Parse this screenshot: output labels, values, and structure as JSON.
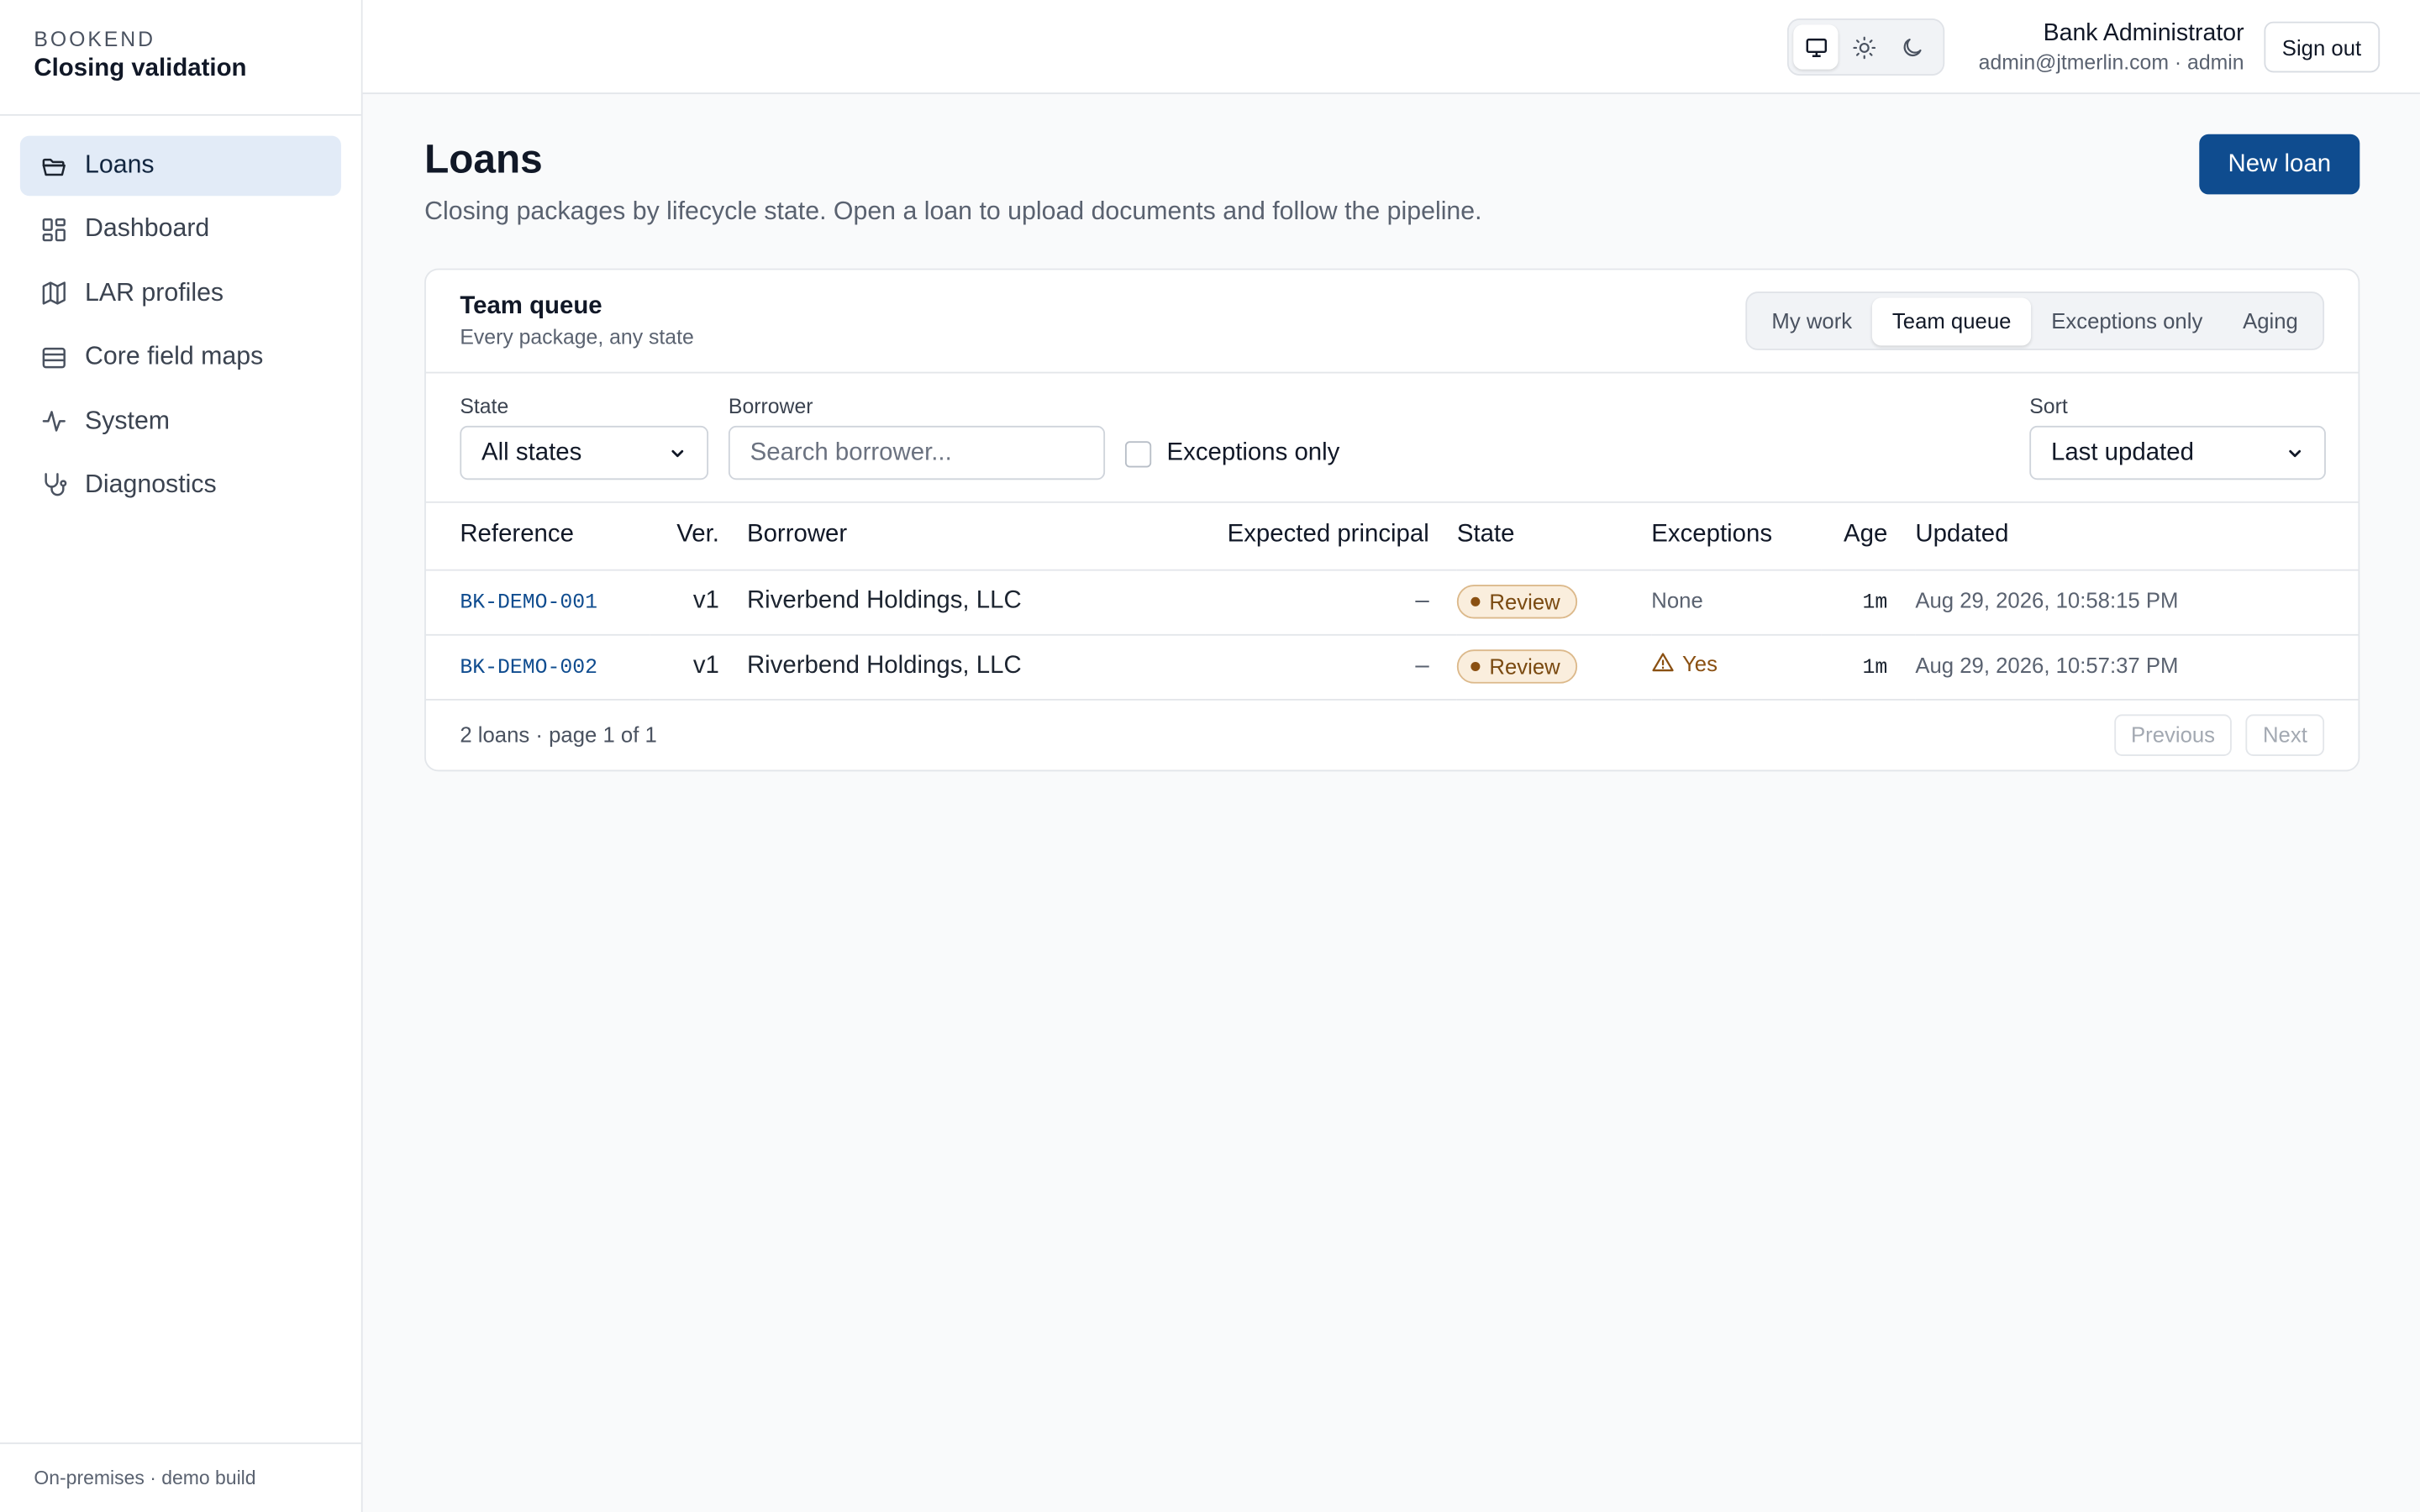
{
  "brand": {
    "eyebrow": "BOOKEND",
    "title": "Closing validation"
  },
  "sidebar": {
    "items": [
      {
        "label": "Loans",
        "icon": "folder-icon",
        "active": true
      },
      {
        "label": "Dashboard",
        "icon": "dashboard-icon"
      },
      {
        "label": "LAR profiles",
        "icon": "map-icon"
      },
      {
        "label": "Core field maps",
        "icon": "table-icon"
      },
      {
        "label": "System",
        "icon": "activity-icon"
      },
      {
        "label": "Diagnostics",
        "icon": "stethoscope-icon"
      }
    ],
    "footer": "On-premises · demo build"
  },
  "topbar": {
    "theme_options": [
      "system",
      "light",
      "dark"
    ],
    "theme_selected": "system",
    "user_name": "Bank Administrator",
    "user_sub": "admin@jtmerlin.com · admin",
    "signout_label": "Sign out"
  },
  "page": {
    "title": "Loans",
    "subtitle": "Closing packages by lifecycle state. Open a loan to upload documents and follow the pipeline.",
    "new_loan_label": "New loan"
  },
  "queue": {
    "title": "Team queue",
    "subtitle": "Every package, any state",
    "tabs": [
      "My work",
      "Team queue",
      "Exceptions only",
      "Aging"
    ],
    "active_tab": "Team queue"
  },
  "filters": {
    "state_label": "State",
    "state_value": "All states",
    "borrower_label": "Borrower",
    "borrower_placeholder": "Search borrower...",
    "exceptions_only_label": "Exceptions only",
    "exceptions_only_checked": false,
    "sort_label": "Sort",
    "sort_value": "Last updated"
  },
  "table": {
    "columns": [
      "Reference",
      "Ver.",
      "Borrower",
      "Expected principal",
      "State",
      "Exceptions",
      "Age",
      "Updated"
    ],
    "rows": [
      {
        "reference": "BK-DEMO-001",
        "version": "v1",
        "borrower": "Riverbend Holdings, LLC",
        "expected_principal": "–",
        "state": "Review",
        "exceptions": "None",
        "age": "1m",
        "updated": "Aug 29, 2026, 10:58:15 PM"
      },
      {
        "reference": "BK-DEMO-002",
        "version": "v1",
        "borrower": "Riverbend Holdings, LLC",
        "expected_principal": "–",
        "state": "Review",
        "exceptions": "Yes",
        "age": "1m",
        "updated": "Aug 29, 2026, 10:57:37 PM"
      }
    ]
  },
  "footer": {
    "summary": "2 loans · page 1 of 1",
    "previous_label": "Previous",
    "next_label": "Next"
  },
  "colors": {
    "accent": "#0f4c8f",
    "nav_active_bg": "#e2ebf7",
    "badge_bg": "#faeedd",
    "badge_text": "#7a4a11"
  }
}
